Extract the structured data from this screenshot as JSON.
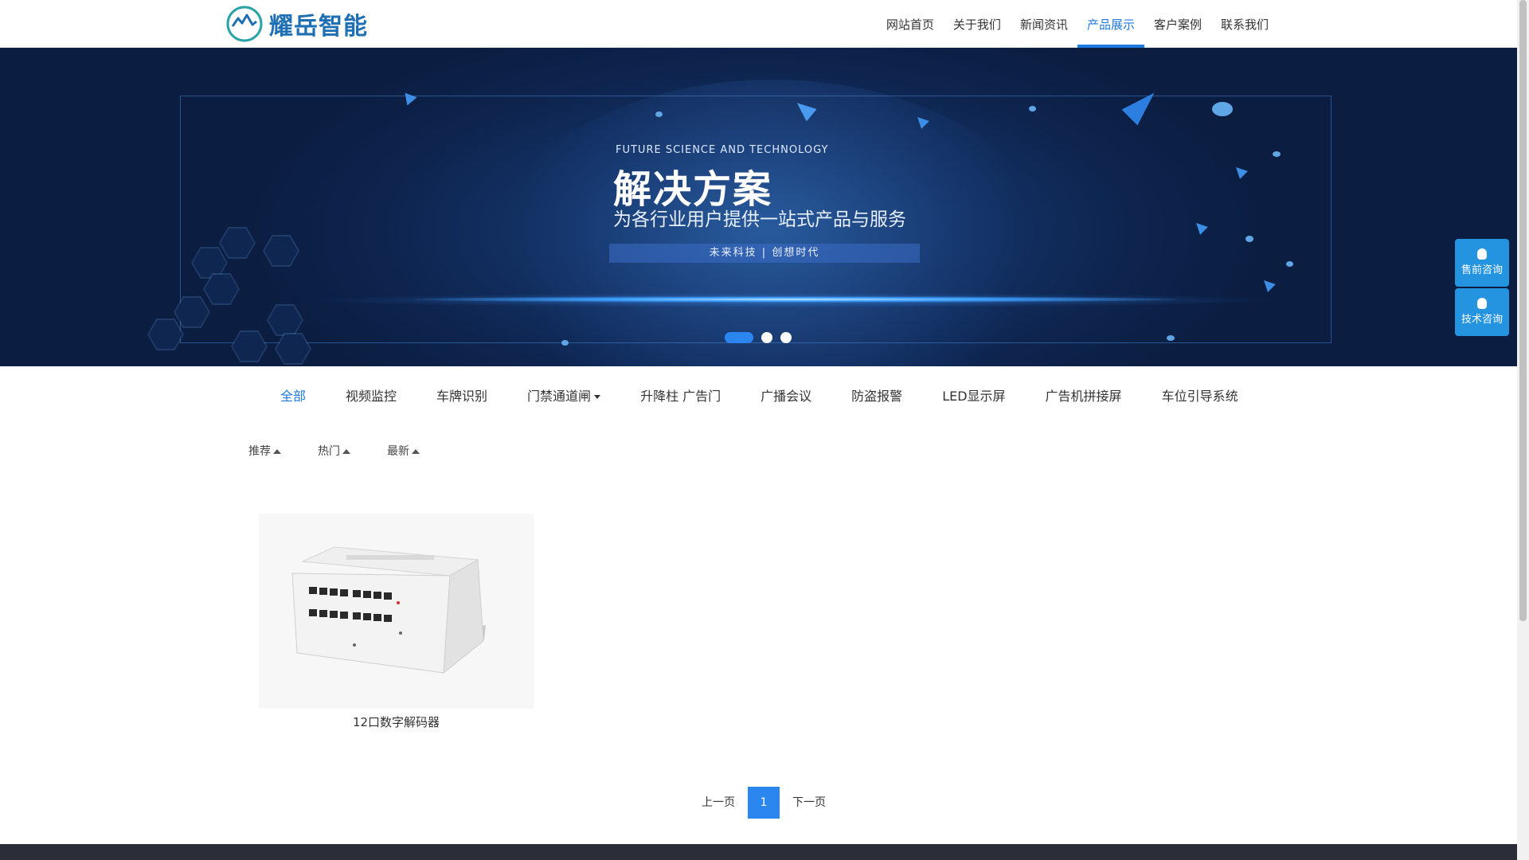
{
  "header": {
    "logo_text": "耀岳智能",
    "nav": [
      {
        "label": "网站首页",
        "active": false
      },
      {
        "label": "关于我们",
        "active": false
      },
      {
        "label": "新闻资讯",
        "active": false
      },
      {
        "label": "产品展示",
        "active": true
      },
      {
        "label": "客户案例",
        "active": false
      },
      {
        "label": "联系我们",
        "active": false
      }
    ]
  },
  "banner": {
    "subtitle_en": "FUTURE SCIENCE AND TECHNOLOGY",
    "title": "解决方案",
    "description": "为各行业用户提供一站式产品与服务",
    "tag": "未来科技 | 创想时代",
    "slides_total": 3,
    "active_slide": 1
  },
  "side": {
    "presale_label": "售前咨询",
    "tech_label": "技术咨询"
  },
  "categories": [
    {
      "label": "全部",
      "active": true,
      "dropdown": false
    },
    {
      "label": "视频监控",
      "active": false,
      "dropdown": false
    },
    {
      "label": "车牌识别",
      "active": false,
      "dropdown": false
    },
    {
      "label": "门禁通道闸",
      "active": false,
      "dropdown": true
    },
    {
      "label": "升降柱 广告门",
      "active": false,
      "dropdown": false
    },
    {
      "label": "广播会议",
      "active": false,
      "dropdown": false
    },
    {
      "label": "防盗报警",
      "active": false,
      "dropdown": false
    },
    {
      "label": "LED显示屏",
      "active": false,
      "dropdown": false
    },
    {
      "label": "广告机拼接屏",
      "active": false,
      "dropdown": false
    },
    {
      "label": "车位引导系统",
      "active": false,
      "dropdown": false
    }
  ],
  "sorts": [
    "推荐",
    "热门",
    "最新"
  ],
  "products": [
    {
      "title": "12口数字解码器"
    }
  ],
  "pagination": {
    "prev": "上一页",
    "current": "1",
    "next": "下一页"
  },
  "colors": {
    "accent": "#1f7ae0",
    "banner_bg": "#0e2550",
    "side_button": "#2493e0",
    "footer": "#2b2e38"
  }
}
